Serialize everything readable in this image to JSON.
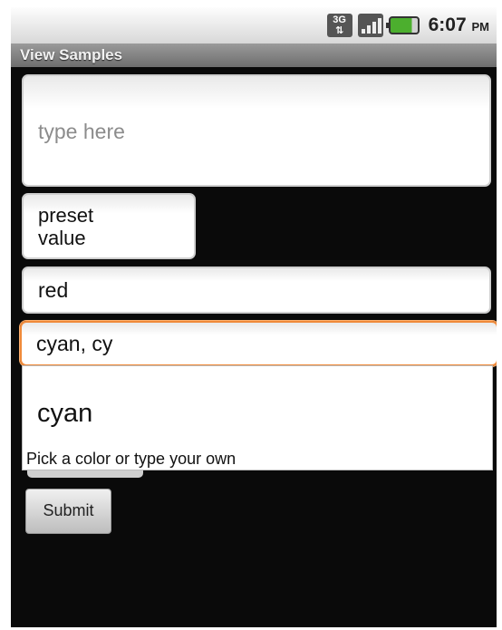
{
  "status_bar": {
    "network_type": "3G",
    "clock_time": "6:07",
    "clock_ampm": "PM",
    "icons": [
      "network-3g-icon",
      "signal-strength-icon",
      "battery-icon"
    ]
  },
  "title_bar": {
    "title": "View Samples"
  },
  "multiline_field": {
    "placeholder": "type here"
  },
  "preset_field": {
    "value_line1": "preset",
    "value_line2": "value"
  },
  "red_field": {
    "value": "red"
  },
  "autocomplete_field": {
    "value": "cyan, cy"
  },
  "dropdown": {
    "items": [
      "cyan"
    ],
    "hint": "Pick a color or type your own"
  },
  "submit_button": {
    "label": "Submit"
  },
  "colors": {
    "focus_border": "#f08a3a",
    "battery_fill": "#4caf2e",
    "screen_background": "#0a0a0a"
  }
}
